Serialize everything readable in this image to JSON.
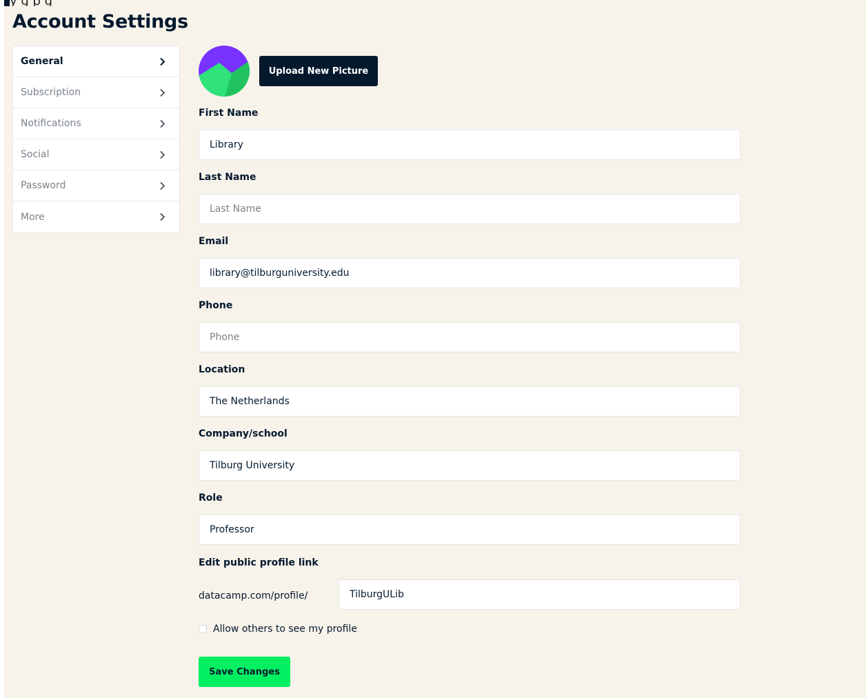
{
  "top_fragment": {
    "highlight": "        ",
    "text": "   y                   g p g"
  },
  "page_title": "Account Settings",
  "colors": {
    "background": "#f7f3eb",
    "navy": "#05192d",
    "green": "#03ef62",
    "avatar_purple": "#7933ff",
    "avatar_green": "#2fe27a"
  },
  "sidebar": {
    "items": [
      {
        "label": "General",
        "active": true,
        "icon": "chevron-right-icon"
      },
      {
        "label": "Subscription",
        "active": false,
        "icon": "chevron-right-icon"
      },
      {
        "label": "Notifications",
        "active": false,
        "icon": "chevron-right-icon"
      },
      {
        "label": "Social",
        "active": false,
        "icon": "chevron-right-icon"
      },
      {
        "label": "Password",
        "active": false,
        "icon": "chevron-right-icon"
      },
      {
        "label": "More",
        "active": false,
        "icon": "chevron-right-icon"
      }
    ]
  },
  "profile": {
    "upload_label": "Upload New Picture"
  },
  "form": {
    "first_name": {
      "label": "First Name",
      "value": "Library",
      "placeholder": "First Name"
    },
    "last_name": {
      "label": "Last Name",
      "value": "",
      "placeholder": "Last Name"
    },
    "email": {
      "label": "Email",
      "value": "library@tilburguniversity.edu",
      "placeholder": "Email"
    },
    "phone": {
      "label": "Phone",
      "value": "",
      "placeholder": "Phone"
    },
    "location": {
      "label": "Location",
      "value": "The Netherlands",
      "placeholder": "Location"
    },
    "company": {
      "label": "Company/school",
      "value": "Tilburg University",
      "placeholder": "Company/school"
    },
    "role": {
      "label": "Role",
      "value": "Professor",
      "placeholder": "Role"
    },
    "profile_link": {
      "label": "Edit public profile link",
      "prefix": "datacamp.com/profile/",
      "value": "TilburgULib"
    },
    "allow_profile": {
      "label": "Allow others to see my profile",
      "checked": false
    },
    "save_label": "Save Changes"
  }
}
